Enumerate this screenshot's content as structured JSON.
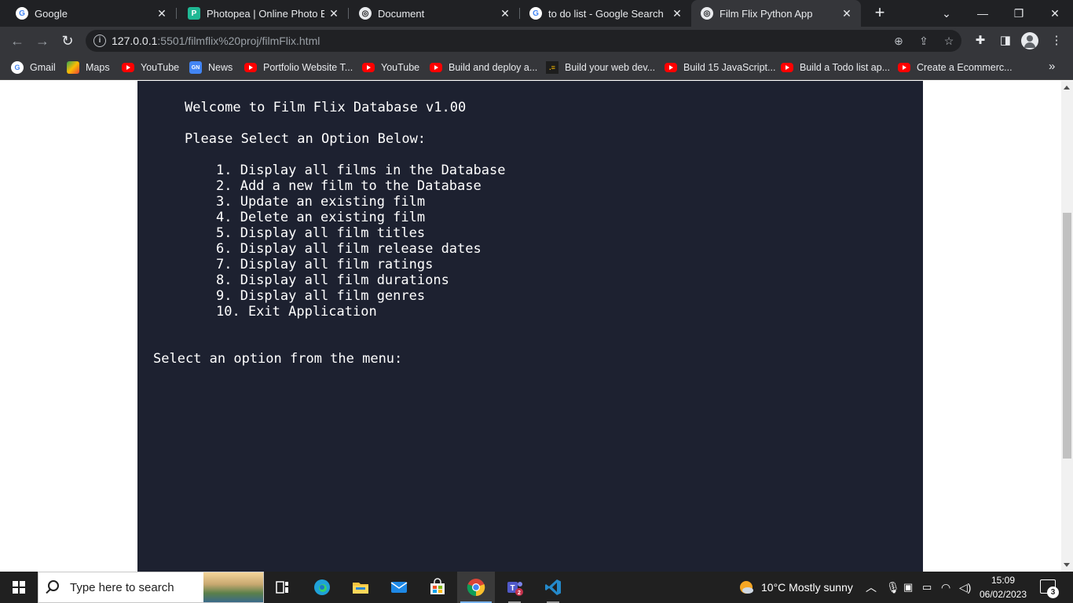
{
  "browser": {
    "tabs": [
      {
        "title": "Google",
        "icon": "google-icon"
      },
      {
        "title": "Photopea | Online Photo Edit",
        "icon": "photopea-icon"
      },
      {
        "title": "Document",
        "icon": "globe-icon"
      },
      {
        "title": "to do list - Google Search",
        "icon": "google-icon"
      },
      {
        "title": "Film Flix Python App",
        "icon": "globe-icon",
        "active": true
      }
    ],
    "address": {
      "host": "127.0.0.1",
      "rest": ":5501/filmflix%20proj/filmFlix.html"
    },
    "bookmarks": [
      {
        "label": "Gmail",
        "icon": "google-icon"
      },
      {
        "label": "Maps",
        "icon": "maps-icon"
      },
      {
        "label": "YouTube",
        "icon": "youtube-icon"
      },
      {
        "label": "News",
        "icon": "news-icon"
      },
      {
        "label": "Portfolio Website T...",
        "icon": "youtube-icon"
      },
      {
        "label": "YouTube",
        "icon": "youtube-icon"
      },
      {
        "label": "Build and deploy a...",
        "icon": "youtube-icon"
      },
      {
        "label": "Build your web dev...",
        "icon": "dev-icon"
      },
      {
        "label": "Build 15 JavaScript...",
        "icon": "youtube-icon"
      },
      {
        "label": "Build a Todo list ap...",
        "icon": "youtube-icon"
      },
      {
        "label": "Create a Ecommerc...",
        "icon": "youtube-icon"
      }
    ]
  },
  "terminal": {
    "welcome": "Welcome to Film Flix Database v1.00",
    "prompt_heading": "Please Select an Option Below:",
    "options": [
      "1. Display all films in the Database",
      "2. Add a new film to the Database",
      "3. Update an existing film",
      "4. Delete an existing film",
      "5. Display all film titles",
      "6. Display all film release dates",
      "7. Display all film ratings",
      "8. Display all film durations",
      "9. Display all film genres",
      "10. Exit Application"
    ],
    "input_prompt": "Select an option from the menu:"
  },
  "taskbar": {
    "search_placeholder": "Type here to search",
    "weather": "10°C  Mostly sunny",
    "time": "15:09",
    "date": "06/02/2023",
    "notification_count": "3",
    "teams_badge": "2"
  },
  "colors": {
    "terminal_bg": "#1d2130",
    "chrome_dark": "#202124",
    "chrome_toolbar": "#35363a",
    "taskbar": "#202020"
  }
}
